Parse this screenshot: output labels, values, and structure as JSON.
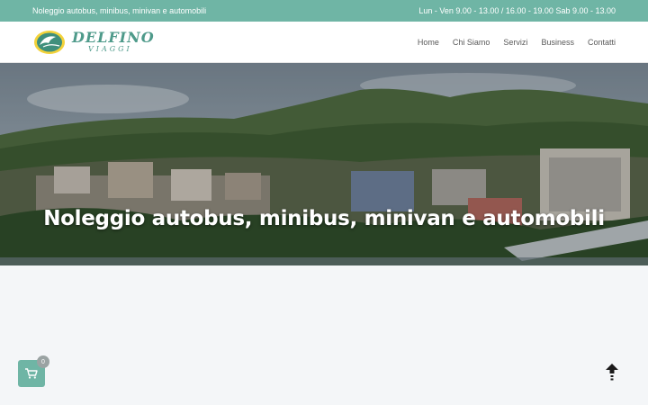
{
  "topbar": {
    "tagline": "Noleggio autobus, minibus, minivan e automobili",
    "hours": "Lun - Ven 9.00 - 13.00 / 16.00 - 19.00 Sab 9.00 - 13.00"
  },
  "logo": {
    "title": "DELFINO",
    "subtitle": "VIAGGI"
  },
  "nav": [
    {
      "label": "Home"
    },
    {
      "label": "Chi Siamo"
    },
    {
      "label": "Servizi"
    },
    {
      "label": "Business"
    },
    {
      "label": "Contatti"
    }
  ],
  "hero": {
    "title": "Noleggio autobus, minibus, minivan e automobili"
  },
  "cart": {
    "count": "0",
    "icon": "cart-icon"
  },
  "scroll_top": {
    "icon": "arrow-up-icon"
  },
  "colors": {
    "accent": "#6fb5a5",
    "brand_text": "#4e9a8a"
  }
}
